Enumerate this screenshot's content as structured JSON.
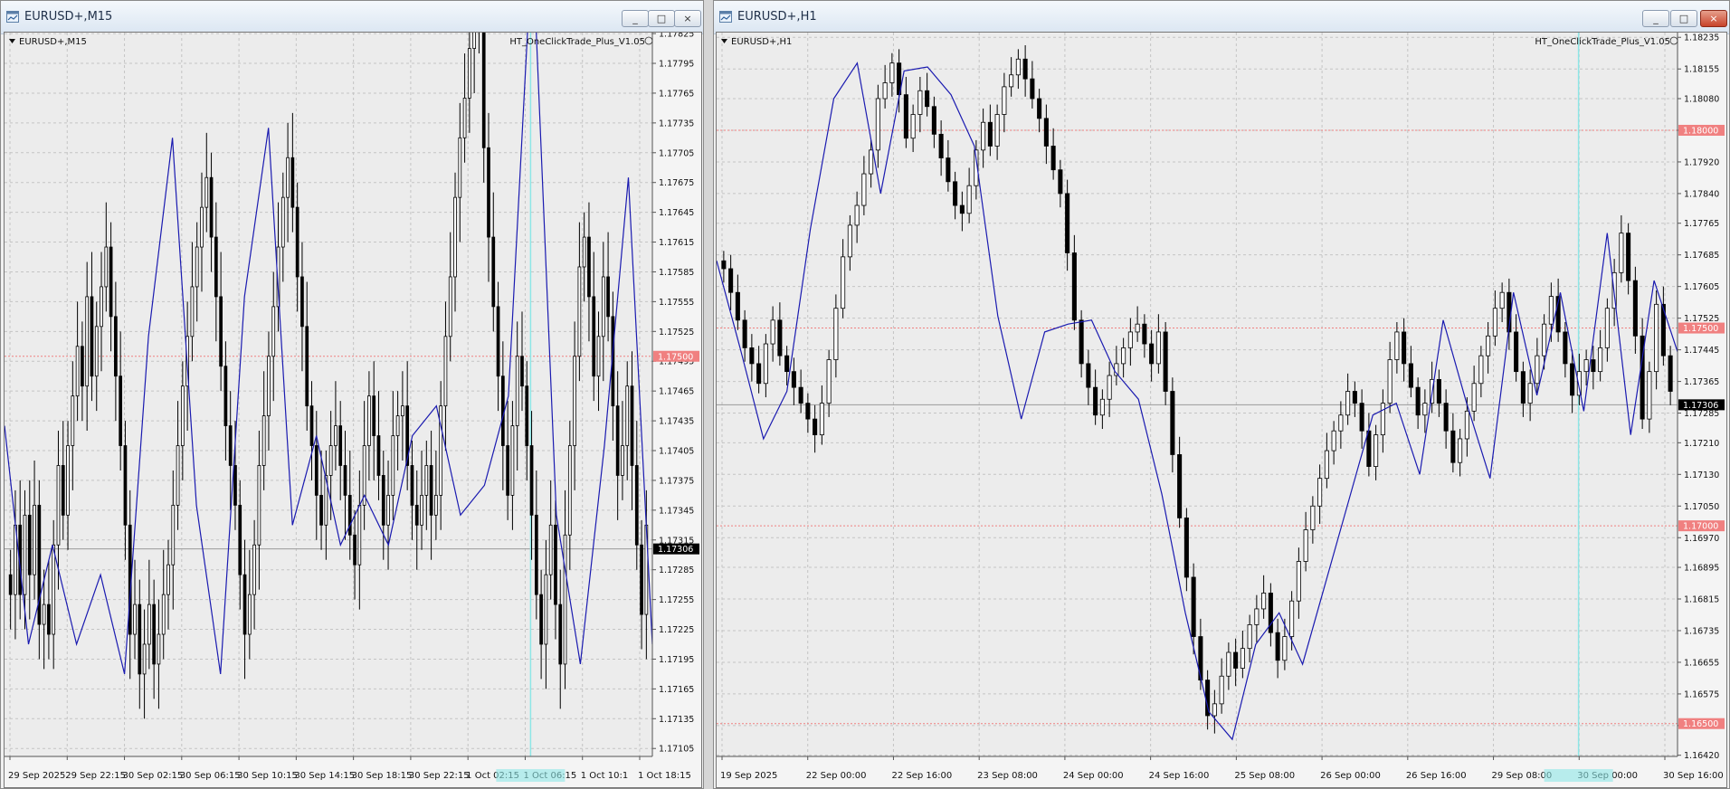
{
  "colors": {
    "candle": "#000000",
    "zigzag": "#1a1ab0",
    "grid": "#c4c4c4",
    "level_line": "#f08080",
    "level_label": "#f08080",
    "bid_line": "#9a9a9a",
    "vline": "#8ee6e6",
    "price_label_bg": "#b4b4b4"
  },
  "windows": [
    {
      "title": "EURUSD+,M15",
      "symbol_label": "EURUSD+,M15",
      "indicator_label": "HT_OneClickTrade_Plus_V1.05",
      "controls": [
        "_",
        "□",
        "×"
      ],
      "chart_data": {
        "type": "candlestick",
        "ylim": [
          1.17097,
          1.17826
        ],
        "y_ticks": [
          "1.17825",
          "1.17795",
          "1.17765",
          "1.17735",
          "1.17705",
          "1.17675",
          "1.17645",
          "1.17615",
          "1.17585",
          "1.17555",
          "1.17525",
          "1.17495",
          "1.17465",
          "1.17435",
          "1.17405",
          "1.17375",
          "1.17345",
          "1.17315",
          "1.17285",
          "1.17255",
          "1.17225",
          "1.17195",
          "1.17165",
          "1.17135",
          "1.17105"
        ],
        "x_ticks": [
          "29 Sep 2025",
          "29 Sep 22:15",
          "30 Sep 02:15",
          "30 Sep 06:15",
          "30 Sep 10:15",
          "30 Sep 14:15",
          "30 Sep 18:15",
          "30 Sep 22:15",
          "1 Oct 02:15",
          "1 Oct 06:15",
          "1 Oct 10:1",
          "1 Oct 18:15"
        ],
        "level_lines": [
          1.175
        ],
        "level_labels": [
          "1.17500"
        ],
        "bid": 1.17306,
        "bid_label": "1.17306",
        "zigzag": [
          1.1743,
          1.1721,
          1.1731,
          1.1721,
          1.1728,
          1.1718,
          1.1752,
          1.1772,
          1.1735,
          1.1718,
          1.1756,
          1.1773,
          1.1733,
          1.1742,
          1.1731,
          1.1736,
          1.1731,
          1.1742,
          1.1745,
          1.1734,
          1.1737,
          1.1746,
          1.1792,
          1.1734,
          1.1719,
          1.1741,
          1.1768,
          1.1721
        ],
        "closes": [
          1.1726,
          1.1733,
          1.1726,
          1.1734,
          1.1728,
          1.1735,
          1.1723,
          1.1725,
          1.1722,
          1.1731,
          1.1739,
          1.1734,
          1.1741,
          1.1746,
          1.1751,
          1.1747,
          1.1756,
          1.1748,
          1.1753,
          1.1757,
          1.1761,
          1.1754,
          1.1748,
          1.1741,
          1.1733,
          1.1722,
          1.1725,
          1.1718,
          1.1721,
          1.1725,
          1.1719,
          1.1722,
          1.1726,
          1.1729,
          1.1735,
          1.1741,
          1.1747,
          1.1752,
          1.1757,
          1.1761,
          1.1765,
          1.1768,
          1.1762,
          1.1756,
          1.1749,
          1.1743,
          1.1739,
          1.1735,
          1.1728,
          1.1722,
          1.1726,
          1.1731,
          1.1739,
          1.1744,
          1.175,
          1.1755,
          1.1761,
          1.1766,
          1.177,
          1.1765,
          1.1758,
          1.1753,
          1.1745,
          1.1741,
          1.1736,
          1.1733,
          1.1738,
          1.1741,
          1.1743,
          1.1739,
          1.1736,
          1.1732,
          1.1729,
          1.1735,
          1.1741,
          1.1746,
          1.1742,
          1.1738,
          1.1733,
          1.1736,
          1.1742,
          1.1744,
          1.1745,
          1.1739,
          1.1735,
          1.1733,
          1.1736,
          1.1739,
          1.1734,
          1.1736,
          1.1745,
          1.1752,
          1.1758,
          1.1766,
          1.1772,
          1.1776,
          1.1781,
          1.1787,
          1.1783,
          1.1771,
          1.1762,
          1.1755,
          1.1748,
          1.1741,
          1.1736,
          1.1743,
          1.175,
          1.1747,
          1.1741,
          1.1734,
          1.1726,
          1.1721,
          1.1728,
          1.1733,
          1.1725,
          1.1719,
          1.1732,
          1.1741,
          1.175,
          1.1759,
          1.1762,
          1.1756,
          1.1748,
          1.1752,
          1.1758,
          1.1754,
          1.1745,
          1.1738,
          1.1741,
          1.1747,
          1.1739,
          1.1731,
          1.1724,
          1.1733
        ],
        "vline_x": 0.812
      }
    },
    {
      "title": "EURUSD+,H1",
      "symbol_label": "EURUSD+,H1",
      "indicator_label": "HT_OneClickTrade_Plus_V1.05",
      "controls": [
        "_",
        "□",
        "×"
      ],
      "chart_data": {
        "type": "candlestick",
        "ylim": [
          1.16417,
          1.18247
        ],
        "y_ticks": [
          "1.18235",
          "1.18155",
          "1.18080",
          "1.18000",
          "1.17920",
          "1.17840",
          "1.17765",
          "1.17685",
          "1.17605",
          "1.17525",
          "1.17445",
          "1.17365",
          "1.17285",
          "1.17210",
          "1.17130",
          "1.17050",
          "1.16970",
          "1.16895",
          "1.16815",
          "1.16735",
          "1.16655",
          "1.16575",
          "1.16495",
          "1.16420"
        ],
        "x_ticks": [
          "19 Sep 2025",
          "22 Sep 00:00",
          "22 Sep 16:00",
          "23 Sep 08:00",
          "24 Sep 00:00",
          "24 Sep 16:00",
          "25 Sep 08:00",
          "26 Sep 00:00",
          "26 Sep 16:00",
          "29 Sep 08:00",
          "30 Sep 00:00",
          "30 Sep 16:00"
        ],
        "level_lines": [
          1.18,
          1.175,
          1.17,
          1.165
        ],
        "level_labels": [
          "1.18000",
          "1.17500",
          "1.17000",
          "1.16500"
        ],
        "bid": 1.17306,
        "bid_label": "1.17306",
        "zigzag": [
          1.1767,
          1.1745,
          1.1722,
          1.1734,
          1.1775,
          1.1808,
          1.1817,
          1.1784,
          1.1815,
          1.1816,
          1.1809,
          1.1796,
          1.1753,
          1.1727,
          1.1749,
          1.1751,
          1.1752,
          1.1739,
          1.1732,
          1.1708,
          1.1678,
          1.1653,
          1.1646,
          1.167,
          1.1678,
          1.1665,
          1.1686,
          1.1707,
          1.1728,
          1.1731,
          1.1713,
          1.1752,
          1.1731,
          1.1712,
          1.1759,
          1.1733,
          1.1759,
          1.1729,
          1.1774,
          1.1723,
          1.1762,
          1.1744
        ],
        "closes": [
          1.1765,
          1.1759,
          1.1752,
          1.1745,
          1.1741,
          1.1736,
          1.1746,
          1.1752,
          1.1743,
          1.1739,
          1.1735,
          1.1731,
          1.1727,
          1.1723,
          1.1731,
          1.1742,
          1.1755,
          1.1768,
          1.1776,
          1.1781,
          1.1789,
          1.1795,
          1.1808,
          1.1812,
          1.1817,
          1.1809,
          1.1798,
          1.1804,
          1.181,
          1.1806,
          1.1799,
          1.1793,
          1.1787,
          1.1781,
          1.1779,
          1.1786,
          1.1795,
          1.1802,
          1.1796,
          1.1804,
          1.1811,
          1.1814,
          1.1818,
          1.1813,
          1.1808,
          1.1803,
          1.1796,
          1.179,
          1.1784,
          1.1769,
          1.1752,
          1.1741,
          1.1735,
          1.1728,
          1.1732,
          1.1738,
          1.1741,
          1.1745,
          1.1749,
          1.1751,
          1.1746,
          1.1741,
          1.1749,
          1.1734,
          1.1718,
          1.1702,
          1.1687,
          1.1672,
          1.1661,
          1.1652,
          1.1655,
          1.1662,
          1.1668,
          1.1664,
          1.1669,
          1.1675,
          1.1679,
          1.1683,
          1.1673,
          1.1666,
          1.1672,
          1.1681,
          1.1691,
          1.1699,
          1.1705,
          1.1712,
          1.1719,
          1.1724,
          1.1728,
          1.1734,
          1.1731,
          1.1724,
          1.1715,
          1.1723,
          1.1731,
          1.1742,
          1.1749,
          1.1741,
          1.1735,
          1.1728,
          1.1731,
          1.1737,
          1.1731,
          1.1724,
          1.1716,
          1.1722,
          1.1729,
          1.1736,
          1.1743,
          1.1748,
          1.1755,
          1.1759,
          1.1749,
          1.1739,
          1.1731,
          1.1736,
          1.1743,
          1.1751,
          1.1758,
          1.1749,
          1.1741,
          1.1733,
          1.1739,
          1.1742,
          1.1739,
          1.1745,
          1.1755,
          1.1764,
          1.1774,
          1.1762,
          1.1748,
          1.1727,
          1.1739,
          1.1756,
          1.1743,
          1.1734
        ],
        "vline_x": 0.897
      }
    }
  ]
}
